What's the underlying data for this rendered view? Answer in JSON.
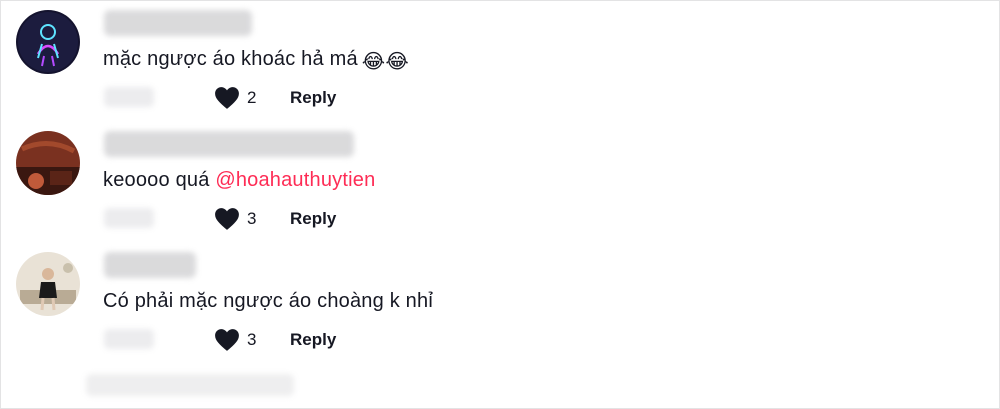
{
  "comments": [
    {
      "text_main": "mặc ngược áo khoác hả má",
      "emoji": "😂😂",
      "likes": "2",
      "reply_label": "Reply",
      "icon": "heart-icon",
      "avatar_colors": [
        "#1c1c3e",
        "#5ee4ff",
        "#d84bff"
      ]
    },
    {
      "text_main": "keoooo quá ",
      "mention": "@hoahauthuytien",
      "likes": "3",
      "reply_label": "Reply",
      "icon": "heart-icon",
      "avatar_colors": [
        "#7a3120",
        "#c05a3a",
        "#2e1410"
      ]
    },
    {
      "text_main": "Có phải mặc ngược áo choàng k nhỉ",
      "likes": "3",
      "reply_label": "Reply",
      "icon": "heart-icon",
      "avatar_colors": [
        "#e9e2d6",
        "#1a1a1a",
        "#b9ab95"
      ]
    }
  ],
  "colors": {
    "mention": "#fe2c55",
    "text": "#161823"
  }
}
